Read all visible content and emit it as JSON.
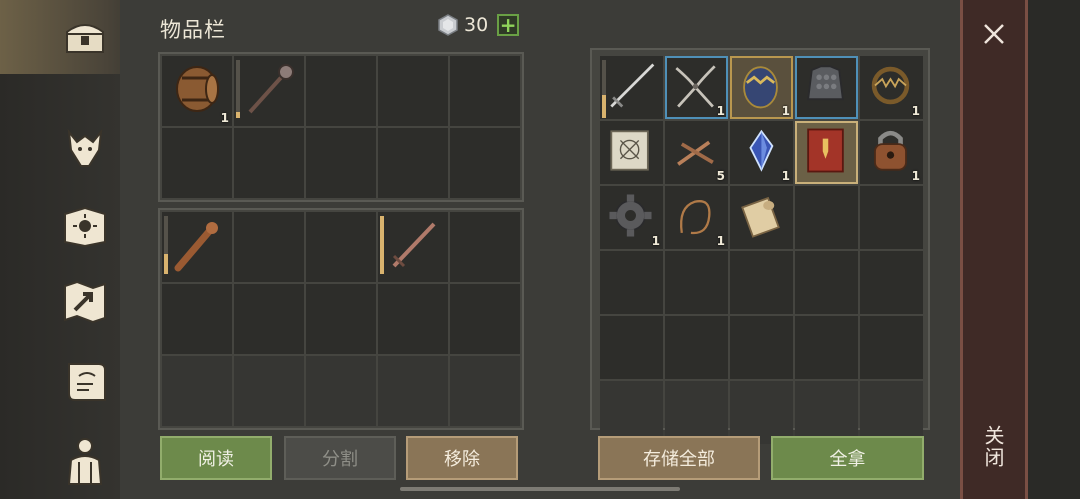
{
  "header": {
    "title": "物品栏",
    "currency_count": "30",
    "plus_label": "+"
  },
  "left_panel": {
    "top_grid": [
      {
        "icon": "barrel-icon",
        "qty": "1"
      },
      {
        "icon": "mace-icon",
        "qty": "",
        "durability": 0.1
      },
      {},
      {},
      {},
      {},
      {},
      {},
      {},
      {}
    ],
    "bottom_grid": [
      {
        "icon": "club-icon",
        "qty": "",
        "durability": 0.35
      },
      {},
      {},
      {
        "icon": "sword-icon",
        "qty": "",
        "durability": 1.0
      },
      {},
      {},
      {},
      {},
      {},
      {},
      {
        "dim": true
      },
      {
        "dim": true
      },
      {
        "dim": true
      },
      {
        "dim": true
      },
      {
        "dim": true
      }
    ]
  },
  "right_panel": {
    "grid": [
      {
        "icon": "longsword-icon",
        "qty": "",
        "durability": 0.4
      },
      {
        "icon": "pliers-icon",
        "qty": "1",
        "highlight": "blue"
      },
      {
        "icon": "egg-icon",
        "qty": "1",
        "highlight": "gold"
      },
      {
        "icon": "chainmail-icon",
        "qty": "",
        "highlight": "blue"
      },
      {
        "icon": "beartrap-icon",
        "qty": "1"
      },
      {
        "icon": "blueprint-icon",
        "qty": ""
      },
      {
        "icon": "nails-icon",
        "qty": "5"
      },
      {
        "icon": "crystal-icon",
        "qty": "1"
      },
      {
        "icon": "book-icon",
        "qty": "",
        "highlight": "yellow"
      },
      {
        "icon": "padlock-icon",
        "qty": "1"
      },
      {
        "icon": "gear-icon",
        "qty": "1"
      },
      {
        "icon": "rope-icon",
        "qty": "1"
      },
      {
        "icon": "scroll-icon",
        "qty": ""
      },
      {},
      {},
      {},
      {},
      {},
      {},
      {},
      {},
      {},
      {},
      {},
      {},
      {
        "dim": true
      },
      {
        "dim": true
      },
      {
        "dim": true
      },
      {
        "dim": true
      },
      {
        "dim": true
      }
    ]
  },
  "buttons": {
    "read": "阅读",
    "split": "分割",
    "remove": "移除",
    "store_all": "存储全部",
    "take_all": "全拿"
  },
  "close": {
    "label": "关闭"
  },
  "colors": {
    "accent_green": "#6d8a4b",
    "durability": "#d9b36e",
    "highlight_blue": "#4f90b8"
  }
}
